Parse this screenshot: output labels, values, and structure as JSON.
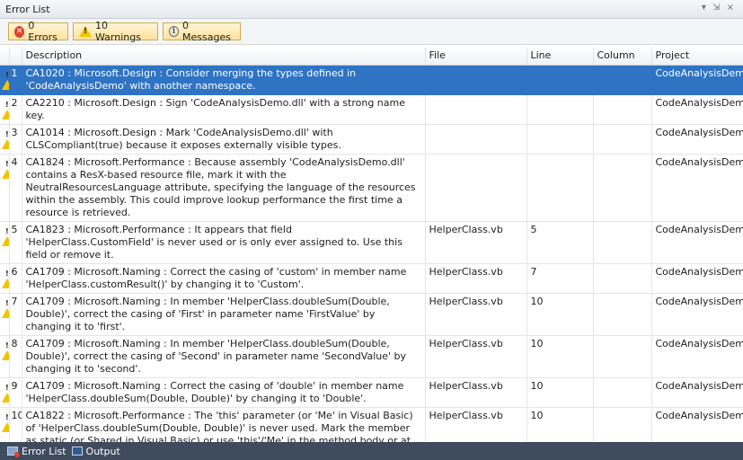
{
  "window": {
    "title": "Error List",
    "controls": "▾ ⇲ ×"
  },
  "toolbar": {
    "errors_label": "0 Errors",
    "warnings_label": "10 Warnings",
    "messages_label": "0 Messages"
  },
  "columns": [
    "",
    "",
    "Description",
    "File",
    "Line",
    "Column",
    "Project"
  ],
  "rows": [
    {
      "num": "1",
      "description": "CA1020 : Microsoft.Design : Consider merging the types defined in 'CodeAnalysisDemo' with another namespace.",
      "file": "",
      "line": "",
      "column": "",
      "project": "CodeAnalysisDemo"
    },
    {
      "num": "2",
      "description": "CA2210 : Microsoft.Design : Sign 'CodeAnalysisDemo.dll' with a strong name key.",
      "file": "",
      "line": "",
      "column": "",
      "project": "CodeAnalysisDemo"
    },
    {
      "num": "3",
      "description": "CA1014 : Microsoft.Design : Mark 'CodeAnalysisDemo.dll' with CLSCompliant(true) because it exposes externally visible types.",
      "file": "",
      "line": "",
      "column": "",
      "project": "CodeAnalysisDemo"
    },
    {
      "num": "4",
      "description": "CA1824 : Microsoft.Performance : Because assembly 'CodeAnalysisDemo.dll' contains a ResX-based resource file, mark it with the NeutralResourcesLanguage attribute, specifying the language of the resources within the assembly. This could improve lookup performance the first time a resource is retrieved.",
      "file": "",
      "line": "",
      "column": "",
      "project": "CodeAnalysisDemo"
    },
    {
      "num": "5",
      "description": "CA1823 : Microsoft.Performance : It appears that field 'HelperClass.CustomField' is never used or is only ever assigned to. Use this field or remove it.",
      "file": "HelperClass.vb",
      "line": "5",
      "column": "",
      "project": "CodeAnalysisDemo"
    },
    {
      "num": "6",
      "description": "CA1709 : Microsoft.Naming : Correct the casing of 'custom' in member name 'HelperClass.customResult()' by changing it to 'Custom'.",
      "file": "HelperClass.vb",
      "line": "7",
      "column": "",
      "project": "CodeAnalysisDemo"
    },
    {
      "num": "7",
      "description": "CA1709 : Microsoft.Naming : In member 'HelperClass.doubleSum(Double, Double)', correct the casing of 'First' in parameter name 'FirstValue' by changing it to 'first'.",
      "file": "HelperClass.vb",
      "line": "10",
      "column": "",
      "project": "CodeAnalysisDemo"
    },
    {
      "num": "8",
      "description": "CA1709 : Microsoft.Naming : In member 'HelperClass.doubleSum(Double, Double)', correct the casing of 'Second' in parameter name 'SecondValue' by changing it to 'second'.",
      "file": "HelperClass.vb",
      "line": "10",
      "column": "",
      "project": "CodeAnalysisDemo"
    },
    {
      "num": "9",
      "description": "CA1709 : Microsoft.Naming : Correct the casing of 'double' in member name 'HelperClass.doubleSum(Double, Double)' by changing it to 'Double'.",
      "file": "HelperClass.vb",
      "line": "10",
      "column": "",
      "project": "CodeAnalysisDemo"
    },
    {
      "num": "10",
      "description": "CA1822 : Microsoft.Performance : The 'this' parameter (or 'Me' in Visual Basic) of 'HelperClass.doubleSum(Double, Double)' is never used. Mark the member as static (or Shared in Visual Basic) or use 'this'/'Me' in the method body or at least one property accessor, if appropriate.",
      "file": "HelperClass.vb",
      "line": "10",
      "column": "",
      "project": "CodeAnalysisDemo"
    }
  ],
  "bottom_tabs": {
    "error_list": "Error List",
    "output": "Output"
  },
  "colors": {
    "selection": "#2f74c4",
    "warning": "#f2c400",
    "error": "#d9452f",
    "bottom_bar": "#3f4b5e"
  }
}
